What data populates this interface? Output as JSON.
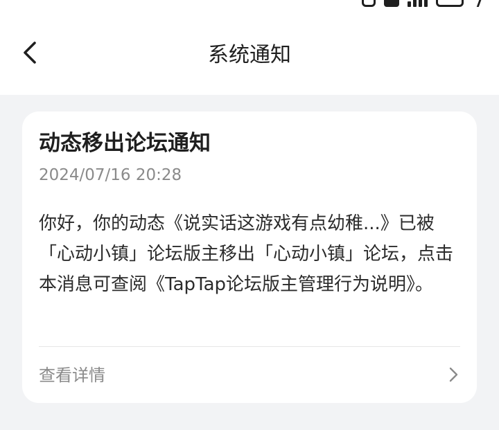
{
  "header": {
    "title": "系统通知",
    "back_icon": "chevron-left-icon"
  },
  "notification": {
    "title": "动态移出论坛通知",
    "timestamp": "2024/07/16 20:28",
    "body": "你好，你的动态《说实话这游戏有点幼稚...》已被「心动小镇」论坛版主移出「心动小镇」论坛，点击本消息可查阅《TapTap论坛版主管理行为说明》。",
    "details_label": "查看详情",
    "details_icon": "chevron-right-icon"
  },
  "colors": {
    "page_background": "#f2f3f5",
    "card_background": "#ffffff",
    "primary_text": "#1f1f1f",
    "secondary_text": "#8a8a8a"
  }
}
